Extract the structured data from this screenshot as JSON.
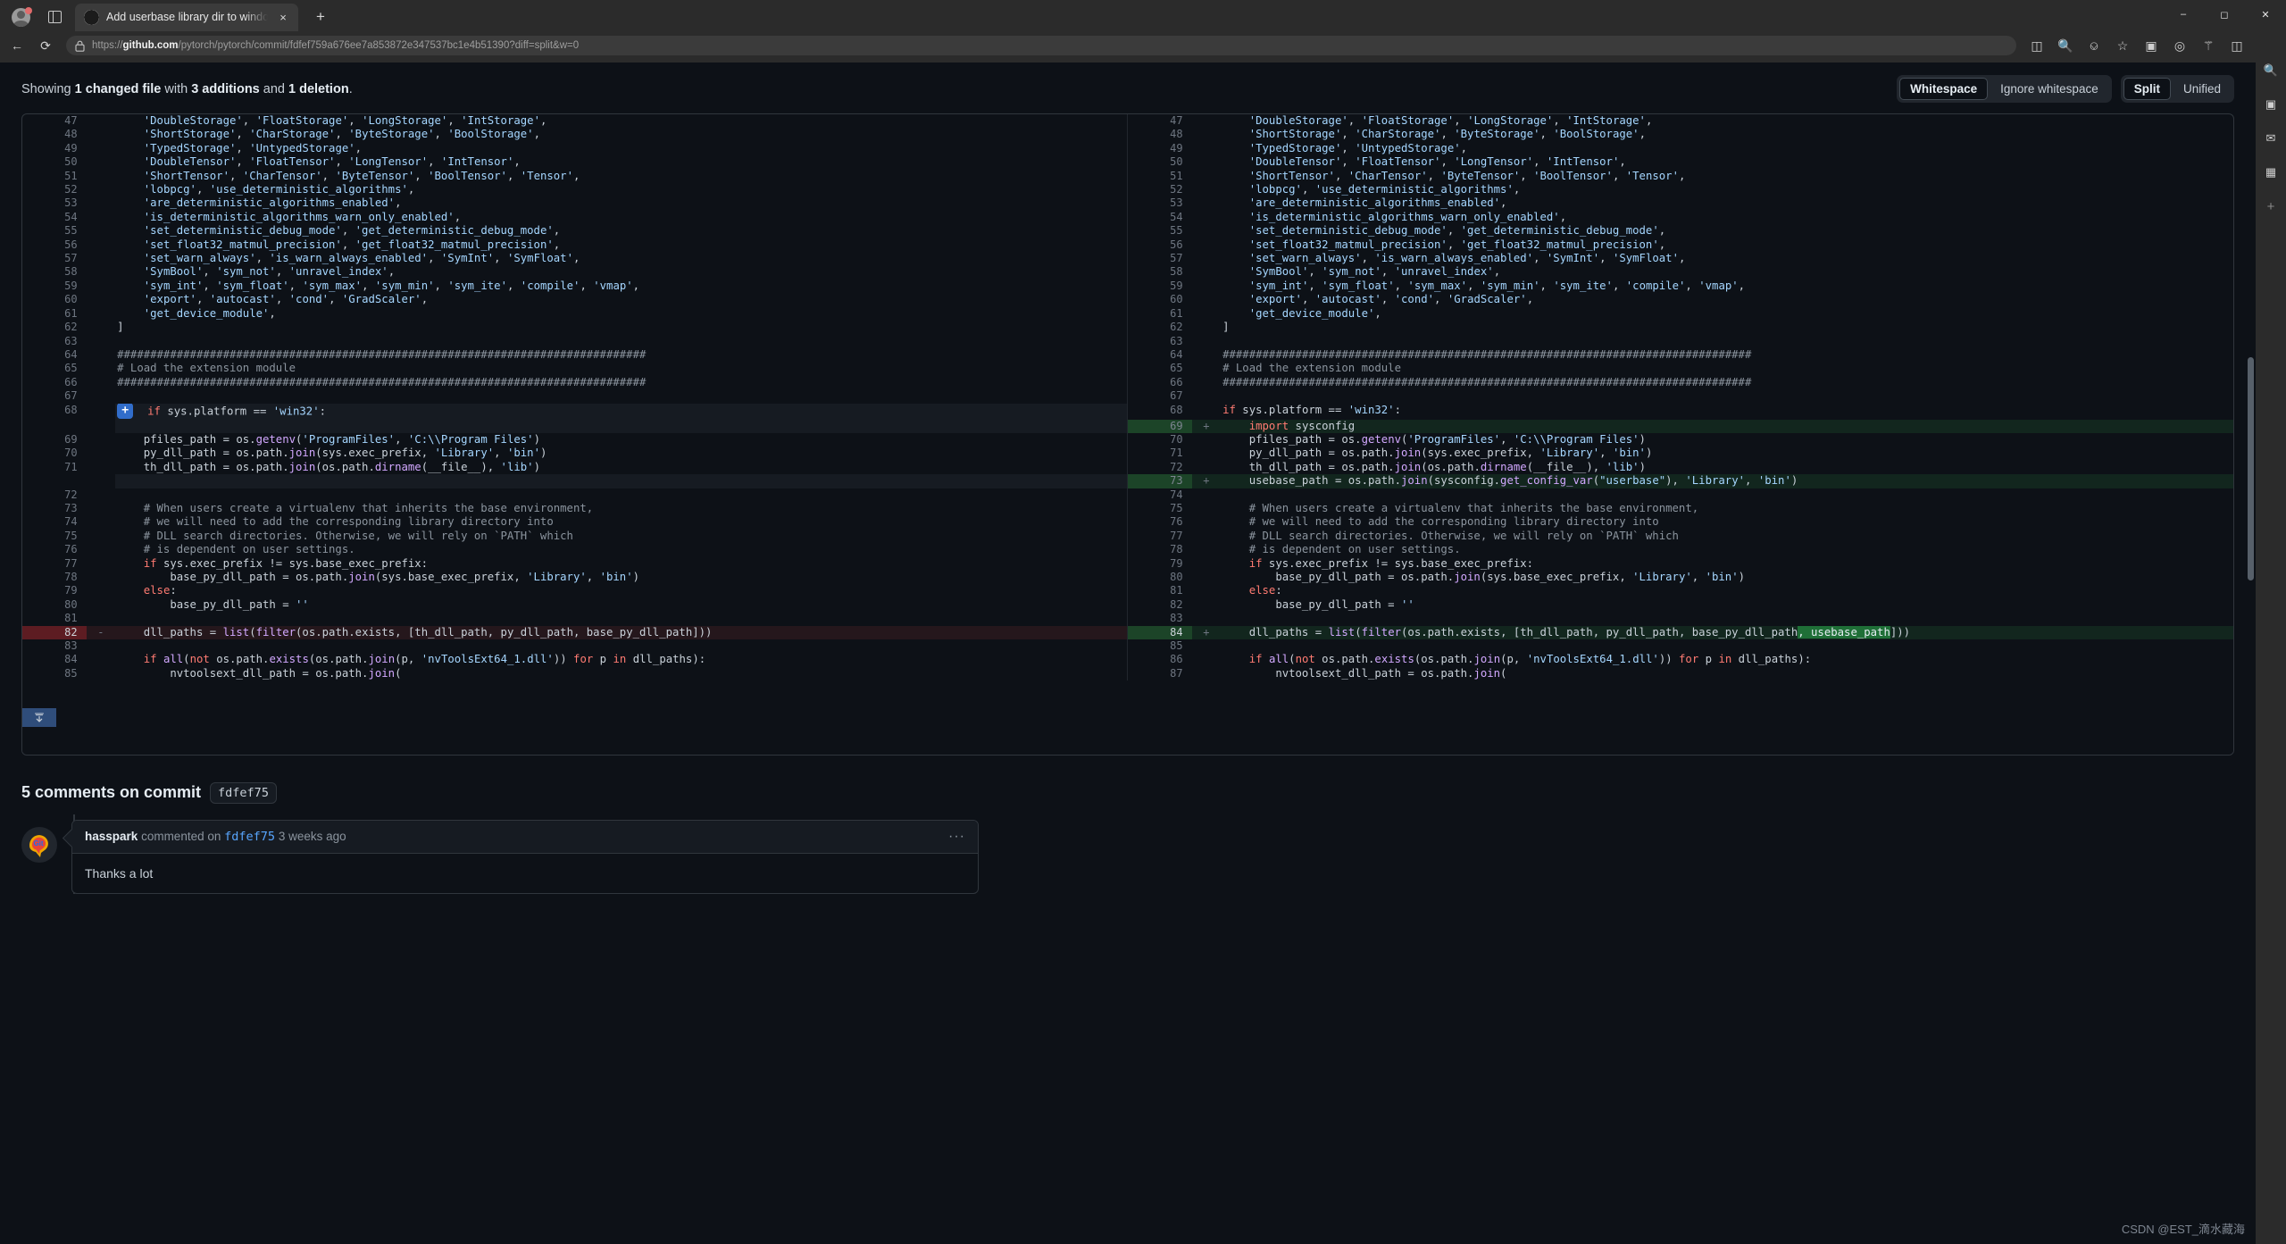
{
  "browser": {
    "tab": {
      "title": "Add userbase library dir to windo",
      "favicon": "github-icon",
      "close": "×"
    },
    "newtab_label": "+",
    "window_controls": {
      "minimize": "—",
      "maximize": "☐",
      "close": "✕"
    },
    "nav": {
      "back": "←",
      "refresh": "⟳"
    },
    "omnibox": {
      "lock": "🔒",
      "url_scheme": "https://",
      "url_domain": "github.com",
      "url_path": "/pytorch/pytorch/commit/fdfef759a676ee7a853872e347537bc1e4b51390?diff=split&w=0"
    },
    "toolbar_icons": [
      "split-screen-icon",
      "zoom-icon",
      "read-aloud-icon",
      "favorite-icon",
      "collections-icon",
      "copilot-icon",
      "browser-essentials-icon",
      "split-screen-panel-icon",
      "settings-more-icon"
    ],
    "rail_icons": [
      "search-icon",
      "copilot-sidebar-icon",
      "outlook-icon",
      "office-icon",
      "add-tool-icon"
    ]
  },
  "diff": {
    "summary_prefix": "Showing ",
    "summary_file": "1 changed file",
    "summary_mid": " with ",
    "summary_additions": "3 additions",
    "summary_and": " and ",
    "summary_deletions": "1 deletion",
    "summary_end": ".",
    "whitespace_group": {
      "active": "Whitespace",
      "inactive": "Ignore whitespace"
    },
    "view_group": {
      "active": "Split",
      "inactive": "Unified"
    },
    "expand_down_label": "expand-down"
  },
  "rows": [
    {
      "type": "ctx",
      "ln": "47",
      "code_left": "    'DoubleStorage', 'FloatStorage', 'LongStorage', 'IntStorage',",
      "rn": "47",
      "code_right": "    'DoubleStorage', 'FloatStorage', 'LongStorage', 'IntStorage',"
    },
    {
      "type": "ctx",
      "ln": "48",
      "code_left": "    'ShortStorage', 'CharStorage', 'ByteStorage', 'BoolStorage',",
      "rn": "48",
      "code_right": "    'ShortStorage', 'CharStorage', 'ByteStorage', 'BoolStorage',"
    },
    {
      "type": "ctx",
      "ln": "49",
      "code_left": "    'TypedStorage', 'UntypedStorage',",
      "rn": "49",
      "code_right": "    'TypedStorage', 'UntypedStorage',"
    },
    {
      "type": "ctx",
      "ln": "50",
      "code_left": "    'DoubleTensor', 'FloatTensor', 'LongTensor', 'IntTensor',",
      "rn": "50",
      "code_right": "    'DoubleTensor', 'FloatTensor', 'LongTensor', 'IntTensor',"
    },
    {
      "type": "ctx",
      "ln": "51",
      "code_left": "    'ShortTensor', 'CharTensor', 'ByteTensor', 'BoolTensor', 'Tensor',",
      "rn": "51",
      "code_right": "    'ShortTensor', 'CharTensor', 'ByteTensor', 'BoolTensor', 'Tensor',"
    },
    {
      "type": "ctx",
      "ln": "52",
      "code_left": "    'lobpcg', 'use_deterministic_algorithms',",
      "rn": "52",
      "code_right": "    'lobpcg', 'use_deterministic_algorithms',"
    },
    {
      "type": "ctx",
      "ln": "53",
      "code_left": "    'are_deterministic_algorithms_enabled',",
      "rn": "53",
      "code_right": "    'are_deterministic_algorithms_enabled',"
    },
    {
      "type": "ctx",
      "ln": "54",
      "code_left": "    'is_deterministic_algorithms_warn_only_enabled',",
      "rn": "54",
      "code_right": "    'is_deterministic_algorithms_warn_only_enabled',"
    },
    {
      "type": "ctx",
      "ln": "55",
      "code_left": "    'set_deterministic_debug_mode', 'get_deterministic_debug_mode',",
      "rn": "55",
      "code_right": "    'set_deterministic_debug_mode', 'get_deterministic_debug_mode',"
    },
    {
      "type": "ctx",
      "ln": "56",
      "code_left": "    'set_float32_matmul_precision', 'get_float32_matmul_precision',",
      "rn": "56",
      "code_right": "    'set_float32_matmul_precision', 'get_float32_matmul_precision',"
    },
    {
      "type": "ctx",
      "ln": "57",
      "code_left": "    'set_warn_always', 'is_warn_always_enabled', 'SymInt', 'SymFloat',",
      "rn": "57",
      "code_right": "    'set_warn_always', 'is_warn_always_enabled', 'SymInt', 'SymFloat',"
    },
    {
      "type": "ctx",
      "ln": "58",
      "code_left": "    'SymBool', 'sym_not', 'unravel_index',",
      "rn": "58",
      "code_right": "    'SymBool', 'sym_not', 'unravel_index',"
    },
    {
      "type": "ctx",
      "ln": "59",
      "code_left": "    'sym_int', 'sym_float', 'sym_max', 'sym_min', 'sym_ite', 'compile', 'vmap',",
      "rn": "59",
      "code_right": "    'sym_int', 'sym_float', 'sym_max', 'sym_min', 'sym_ite', 'compile', 'vmap',"
    },
    {
      "type": "ctx",
      "ln": "60",
      "code_left": "    'export', 'autocast', 'cond', 'GradScaler',",
      "rn": "60",
      "code_right": "    'export', 'autocast', 'cond', 'GradScaler',"
    },
    {
      "type": "ctx",
      "ln": "61",
      "code_left": "    'get_device_module',",
      "rn": "61",
      "code_right": "    'get_device_module',"
    },
    {
      "type": "ctx",
      "ln": "62",
      "code_left": "]",
      "rn": "62",
      "code_right": "]"
    },
    {
      "type": "ctx",
      "ln": "63",
      "code_left": "",
      "rn": "63",
      "code_right": ""
    },
    {
      "type": "ctx",
      "ln": "64",
      "code_left": "################################################################################",
      "rn": "64",
      "code_right": "################################################################################"
    },
    {
      "type": "ctx",
      "ln": "65",
      "code_left": "# Load the extension module",
      "rn": "65",
      "code_right": "# Load the extension module"
    },
    {
      "type": "ctx",
      "ln": "66",
      "code_left": "################################################################################",
      "rn": "66",
      "code_right": "################################################################################"
    },
    {
      "type": "ctx",
      "ln": "67",
      "code_left": "",
      "rn": "67",
      "code_right": ""
    },
    {
      "type": "hover",
      "ln": "68",
      "code_left": "if sys.platform == 'win32':",
      "rn": "68",
      "code_right": "if sys.platform == 'win32':"
    },
    {
      "type": "add-right",
      "ln": "",
      "code_left": "",
      "rn": "69",
      "code_right": "    import sysconfig"
    },
    {
      "type": "ctx",
      "ln": "69",
      "code_left": "    pfiles_path = os.getenv('ProgramFiles', 'C:\\\\Program Files')",
      "rn": "70",
      "code_right": "    pfiles_path = os.getenv('ProgramFiles', 'C:\\\\Program Files')"
    },
    {
      "type": "ctx",
      "ln": "70",
      "code_left": "    py_dll_path = os.path.join(sys.exec_prefix, 'Library', 'bin')",
      "rn": "71",
      "code_right": "    py_dll_path = os.path.join(sys.exec_prefix, 'Library', 'bin')"
    },
    {
      "type": "ctx",
      "ln": "71",
      "code_left": "    th_dll_path = os.path.join(os.path.dirname(__file__), 'lib')",
      "rn": "72",
      "code_right": "    th_dll_path = os.path.join(os.path.dirname(__file__), 'lib')"
    },
    {
      "type": "add-right2",
      "ln": "",
      "code_left": "",
      "rn": "73",
      "code_right": "    usebase_path = os.path.join(sysconfig.get_config_var(\"userbase\"), 'Library', 'bin')"
    },
    {
      "type": "ctx",
      "ln": "72",
      "code_left": "",
      "rn": "74",
      "code_right": ""
    },
    {
      "type": "ctx",
      "ln": "73",
      "code_left": "    # When users create a virtualenv that inherits the base environment,",
      "rn": "75",
      "code_right": "    # When users create a virtualenv that inherits the base environment,"
    },
    {
      "type": "ctx",
      "ln": "74",
      "code_left": "    # we will need to add the corresponding library directory into",
      "rn": "76",
      "code_right": "    # we will need to add the corresponding library directory into"
    },
    {
      "type": "ctx",
      "ln": "75",
      "code_left": "    # DLL search directories. Otherwise, we will rely on `PATH` which",
      "rn": "77",
      "code_right": "    # DLL search directories. Otherwise, we will rely on `PATH` which"
    },
    {
      "type": "ctx",
      "ln": "76",
      "code_left": "    # is dependent on user settings.",
      "rn": "78",
      "code_right": "    # is dependent on user settings."
    },
    {
      "type": "ctx",
      "ln": "77",
      "code_left": "    if sys.exec_prefix != sys.base_exec_prefix:",
      "rn": "79",
      "code_right": "    if sys.exec_prefix != sys.base_exec_prefix:"
    },
    {
      "type": "ctx",
      "ln": "78",
      "code_left": "        base_py_dll_path = os.path.join(sys.base_exec_prefix, 'Library', 'bin')",
      "rn": "80",
      "code_right": "        base_py_dll_path = os.path.join(sys.base_exec_prefix, 'Library', 'bin')"
    },
    {
      "type": "ctx",
      "ln": "79",
      "code_left": "    else:",
      "rn": "81",
      "code_right": "    else:"
    },
    {
      "type": "ctx",
      "ln": "80",
      "code_left": "        base_py_dll_path = ''",
      "rn": "82",
      "code_right": "        base_py_dll_path = ''"
    },
    {
      "type": "ctx",
      "ln": "81",
      "code_left": "",
      "rn": "83",
      "code_right": ""
    },
    {
      "type": "change",
      "ln": "82",
      "code_left": "    dll_paths = list(filter(os.path.exists, [th_dll_path, py_dll_path, base_py_dll_path]))",
      "rn": "84",
      "code_right": "    dll_paths = list(filter(os.path.exists, [th_dll_path, py_dll_path, base_py_dll_path, usebase_path]))"
    },
    {
      "type": "ctx",
      "ln": "83",
      "code_left": "",
      "rn": "85",
      "code_right": ""
    },
    {
      "type": "ctx",
      "ln": "84",
      "code_left": "    if all(not os.path.exists(os.path.join(p, 'nvToolsExt64_1.dll')) for p in dll_paths):",
      "rn": "86",
      "code_right": "    if all(not os.path.exists(os.path.join(p, 'nvToolsExt64_1.dll')) for p in dll_paths):"
    },
    {
      "type": "ctx",
      "ln": "85",
      "code_left": "        nvtoolsext_dll_path = os.path.join(",
      "rn": "87",
      "code_right": "        nvtoolsext_dll_path = os.path.join("
    }
  ],
  "comments": {
    "heading_count": "5 comments on commit",
    "heading_sha": "fdfef75",
    "items": [
      {
        "author": "hasspark",
        "verb": "commented on",
        "sha": "fdfef75",
        "time": "3 weeks ago",
        "menu": "···",
        "body": "Thanks a lot"
      }
    ]
  },
  "watermark": "CSDN @EST_滴水藏海"
}
